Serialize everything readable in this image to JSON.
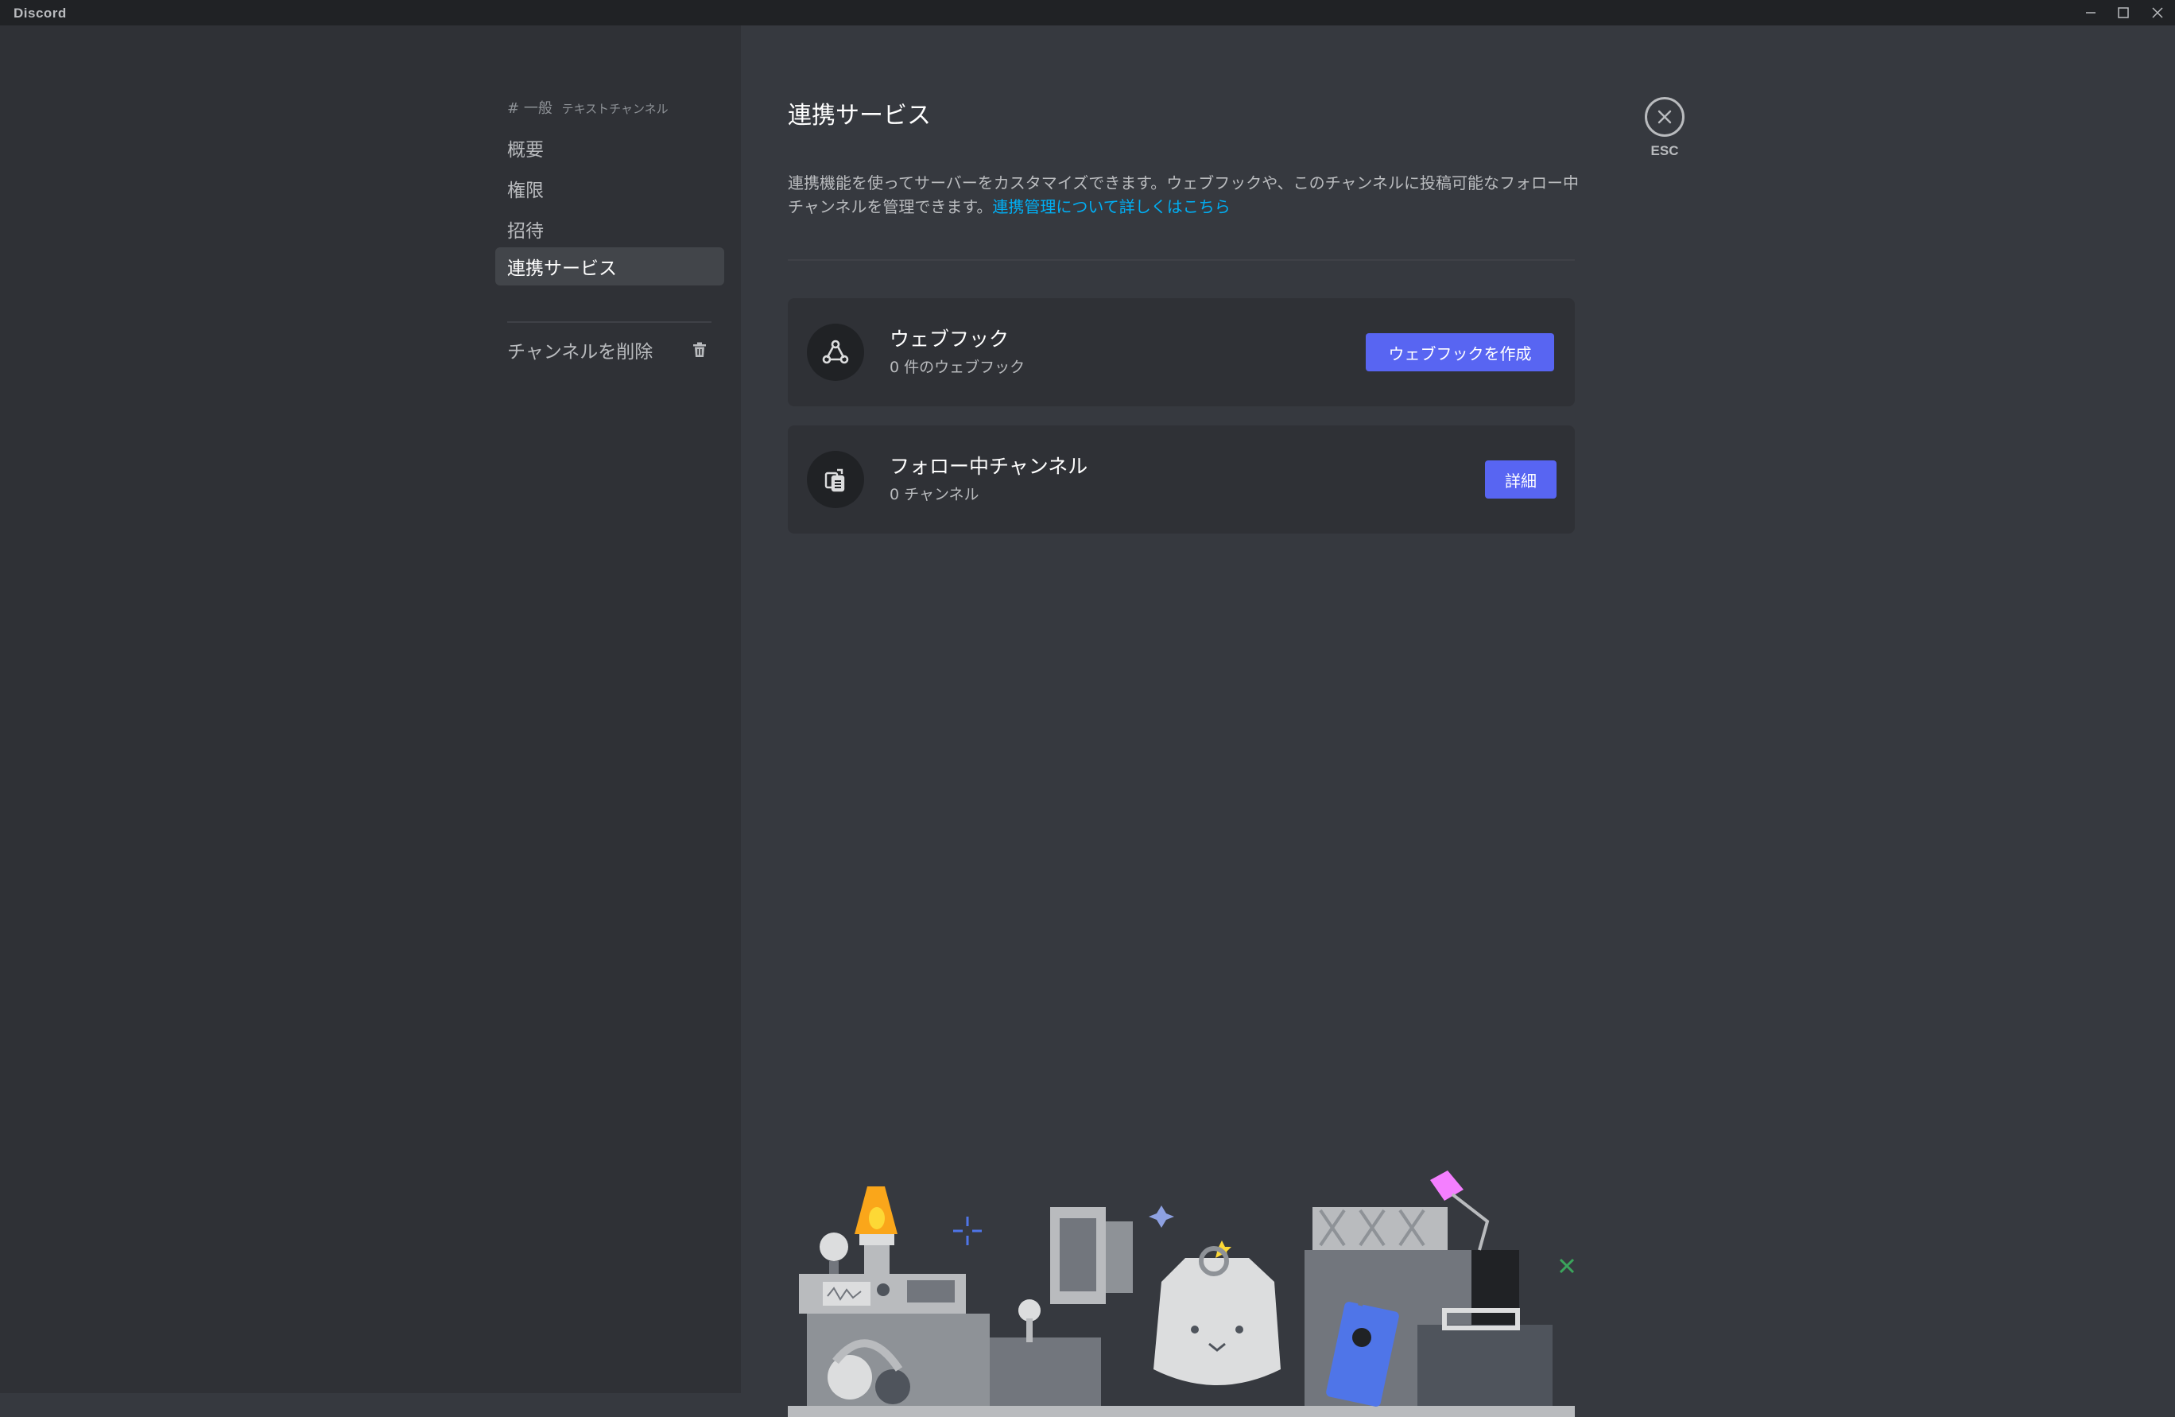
{
  "window": {
    "app_title": "Discord"
  },
  "sidebar": {
    "channel_prefix": "#",
    "channel_name": "一般",
    "channel_category": "テキストチャンネル",
    "items": [
      {
        "label": "概要",
        "active": false
      },
      {
        "label": "権限",
        "active": false
      },
      {
        "label": "招待",
        "active": false
      },
      {
        "label": "連携サービス",
        "active": true
      }
    ],
    "delete_label": "チャンネルを削除"
  },
  "main": {
    "title": "連携サービス",
    "description": "連携機能を使ってサーバーをカスタマイズできます。ウェブフックや、このチャンネルに投稿可能なフォロー中チャンネルを管理できます。",
    "description_link": "連携管理について詳しくはこちら",
    "webhook": {
      "title": "ウェブフック",
      "subtitle": "0 件のウェブフック",
      "button": "ウェブフックを作成"
    },
    "following": {
      "title": "フォロー中チャンネル",
      "subtitle": "0 チャンネル",
      "button": "詳細"
    },
    "close_label": "ESC"
  },
  "colors": {
    "background": "#36393f",
    "sidebar": "#2f3136",
    "titlebar": "#202225",
    "brand": "#5865f2",
    "link": "#00aff4"
  }
}
